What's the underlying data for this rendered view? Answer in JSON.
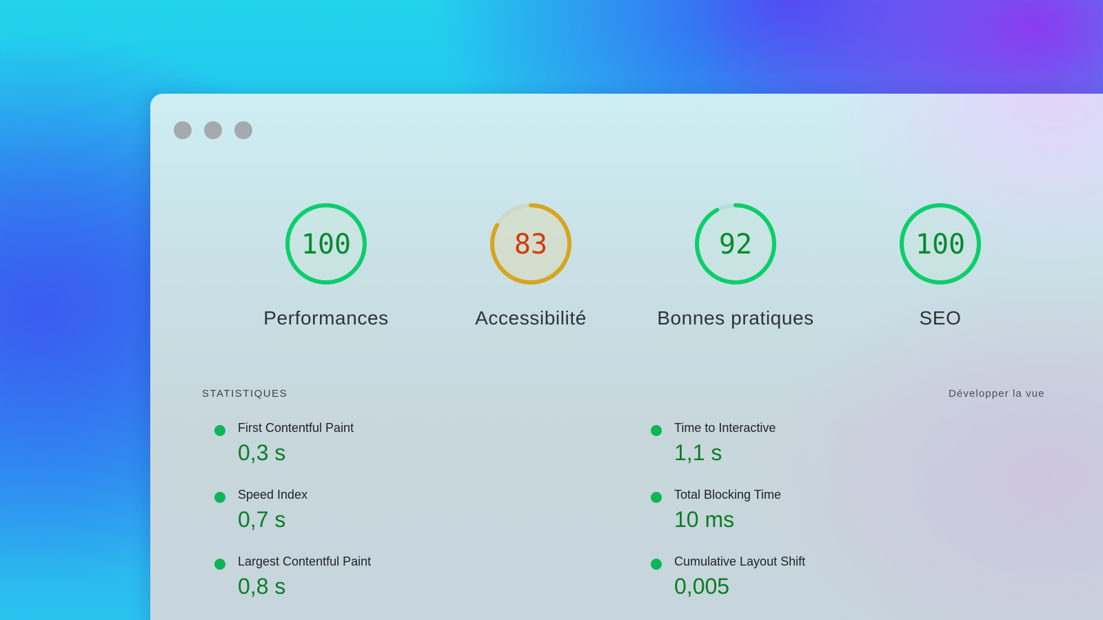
{
  "window": {
    "traffic_lights": [
      "close",
      "minimize",
      "zoom"
    ]
  },
  "scores": [
    {
      "value": 100,
      "label": "Performances",
      "rating": "pass",
      "color": "#0cce6b",
      "text_color": "#078a2c"
    },
    {
      "value": 83,
      "label": "Accessibilité",
      "rating": "average",
      "color": "#d7a51f",
      "text_color": "#d33a10"
    },
    {
      "value": 92,
      "label": "Bonnes pratiques",
      "rating": "pass",
      "color": "#0cce6b",
      "text_color": "#078a2c"
    },
    {
      "value": 100,
      "label": "SEO",
      "rating": "pass",
      "color": "#0cce6b",
      "text_color": "#078a2c"
    }
  ],
  "stats": {
    "heading": "STATISTIQUES",
    "expand_label": "Développer la vue",
    "metrics": [
      {
        "label": "First Contentful Paint",
        "value": "0,3 s",
        "status_color": "#0cb655"
      },
      {
        "label": "Speed Index",
        "value": "0,7 s",
        "status_color": "#0cb655"
      },
      {
        "label": "Largest Contentful Paint",
        "value": "0,8 s",
        "status_color": "#0cb655"
      },
      {
        "label": "Time to Interactive",
        "value": "1,1 s",
        "status_color": "#0cb655"
      },
      {
        "label": "Total Blocking Time",
        "value": "10 ms",
        "status_color": "#0cb655"
      },
      {
        "label": "Cumulative Layout Shift",
        "value": "0,005",
        "status_color": "#0cb655"
      }
    ]
  }
}
